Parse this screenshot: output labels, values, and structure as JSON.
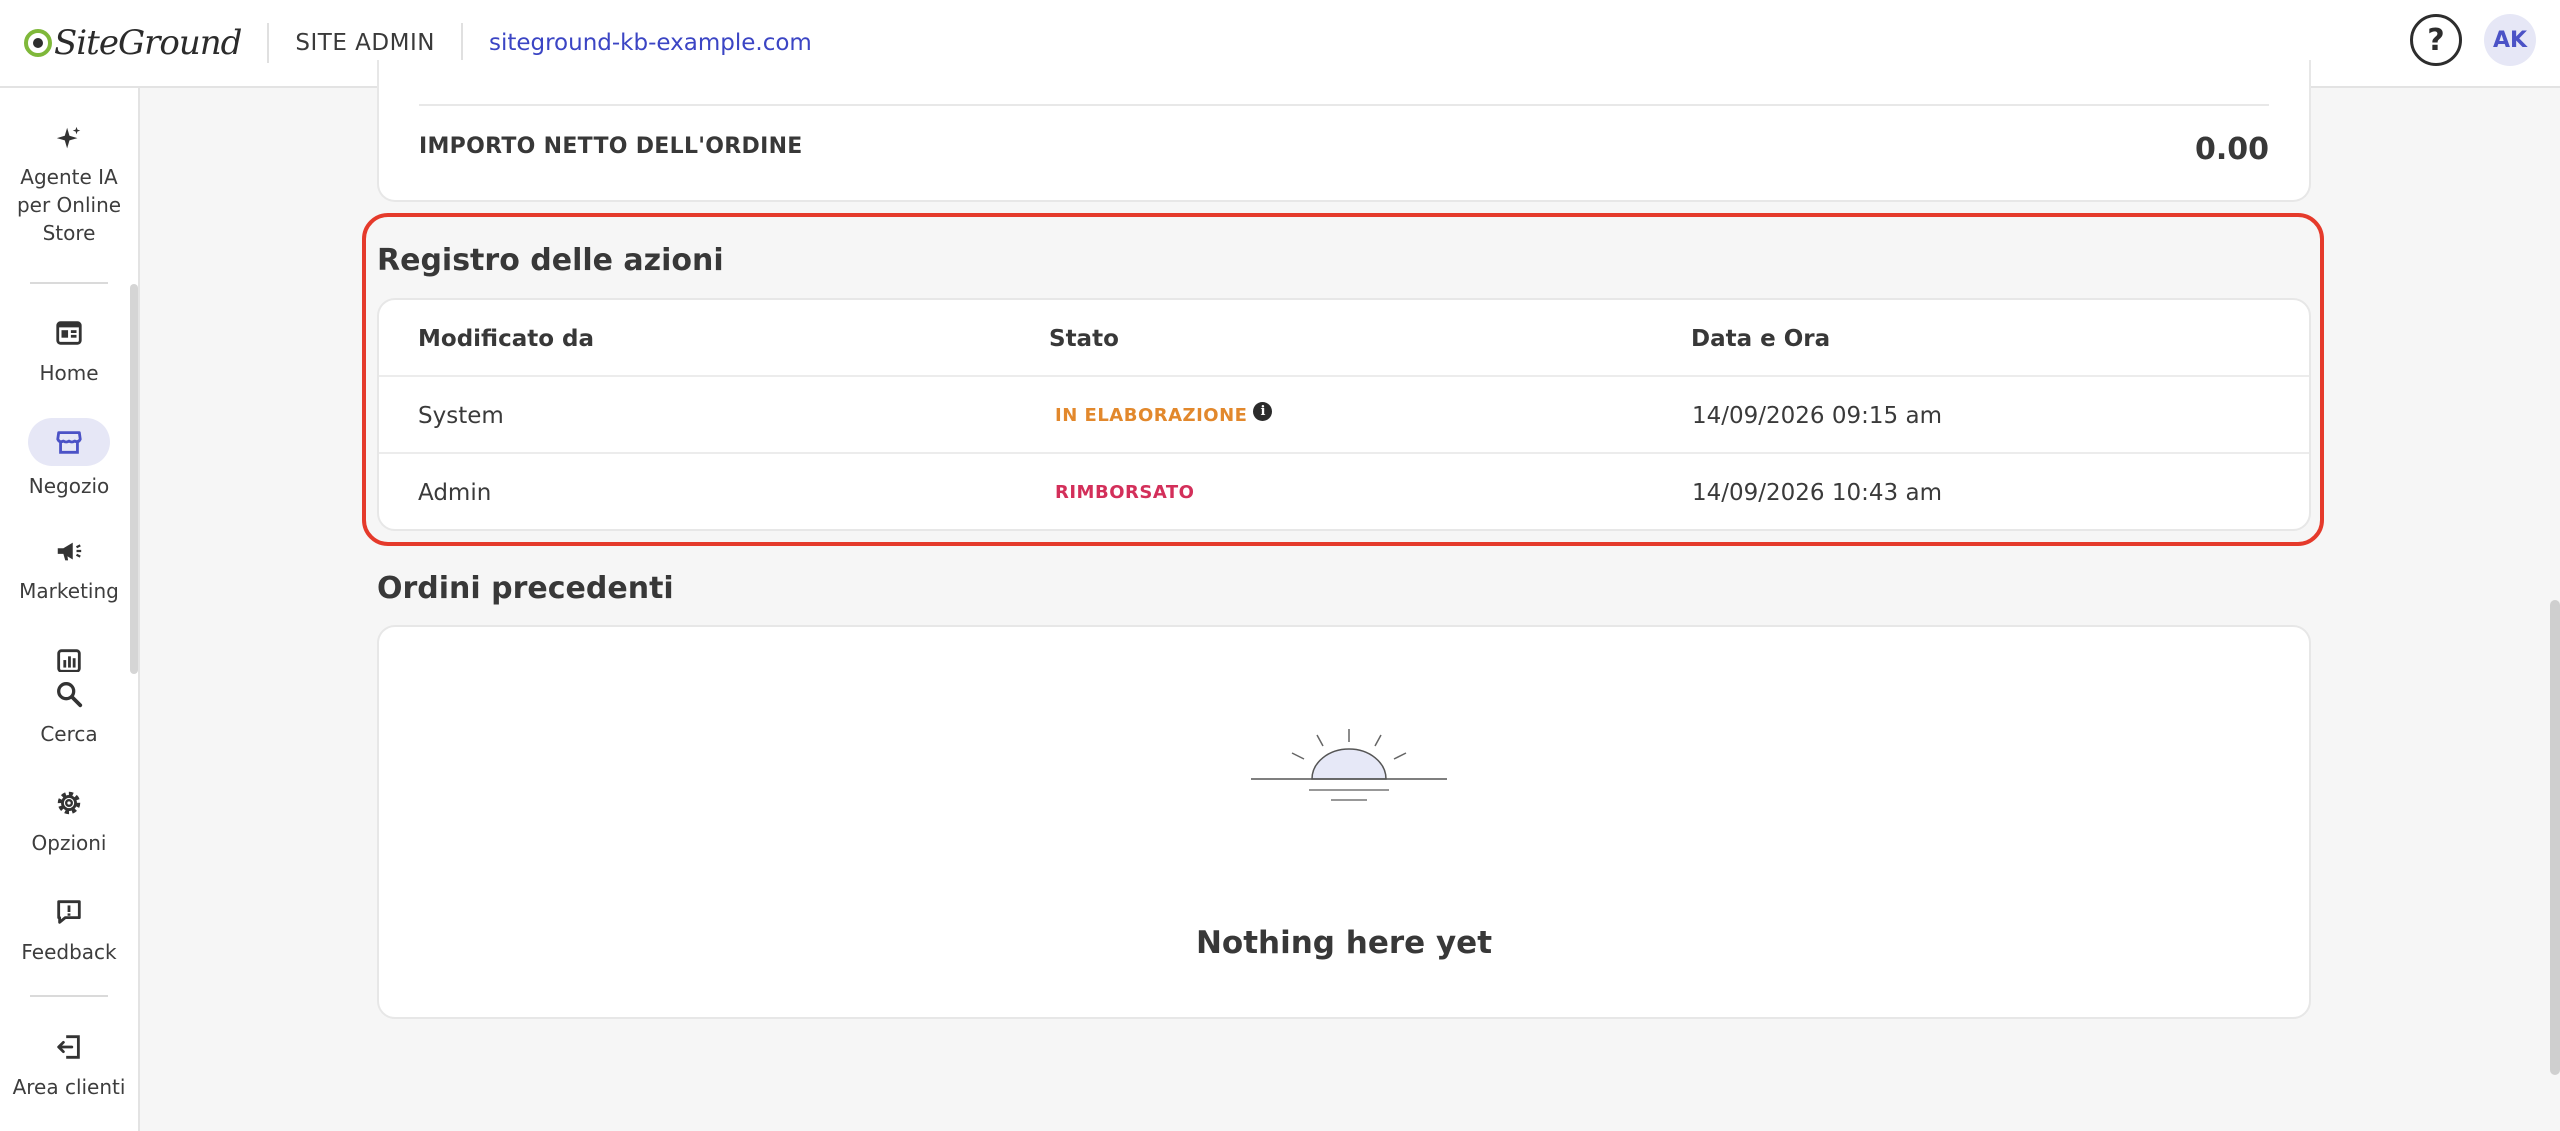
{
  "header": {
    "logo_text": "SiteGround",
    "site_admin": "SITE ADMIN",
    "domain": "siteground-kb-example.com",
    "help_glyph": "?",
    "avatar_initials": "AK"
  },
  "sidebar": {
    "items": [
      {
        "label": "Agente IA per Online Store",
        "icon": "sparkle-icon"
      },
      {
        "label": "Home",
        "icon": "dashboard-icon"
      },
      {
        "label": "Negozio",
        "icon": "store-icon",
        "active": true
      },
      {
        "label": "Marketing",
        "icon": "megaphone-icon"
      },
      {
        "label": "Cerca",
        "icon": "search-icon"
      },
      {
        "label": "Opzioni",
        "icon": "gear-icon"
      },
      {
        "label": "Feedback",
        "icon": "feedback-icon"
      },
      {
        "label": "Area clienti",
        "icon": "exit-icon"
      }
    ]
  },
  "order_summary": {
    "net_label": "IMPORTO NETTO DELL'ORDINE",
    "net_value": "0.00"
  },
  "action_log": {
    "title": "Registro delle azioni",
    "columns": [
      "Modificato da",
      "Stato",
      "Data e Ora"
    ],
    "rows": [
      {
        "by": "System",
        "status": "IN ELABORAZIONE",
        "status_color": "#e2882c",
        "info_glyph": "i",
        "datetime": "14/09/2026 09:15 am"
      },
      {
        "by": "Admin",
        "status": "RIMBORSATO",
        "status_color": "#d32f5a",
        "datetime": "14/09/2026 10:43 am"
      }
    ]
  },
  "previous_orders": {
    "title": "Ordini precedenti",
    "empty_text": "Nothing here yet"
  },
  "colors": {
    "accent": "#3b45c4",
    "highlight": "#e53a2b",
    "brand_green": "#7fb83a"
  }
}
